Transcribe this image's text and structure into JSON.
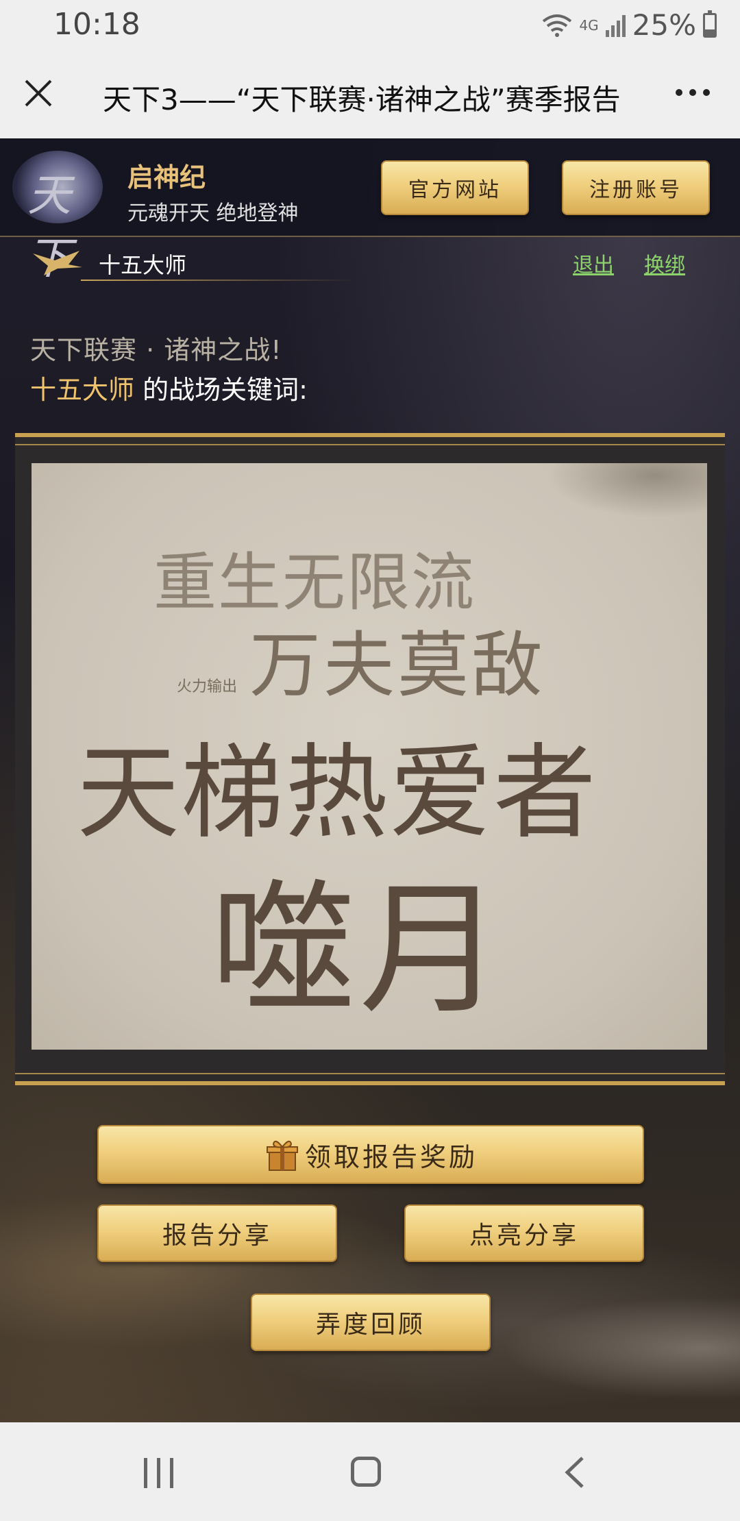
{
  "status_bar": {
    "time": "10:18",
    "network": "4G",
    "battery": "25%",
    "icons": [
      "wifi-icon",
      "cellular-signal-icon",
      "battery-icon"
    ]
  },
  "title_bar": {
    "title": "天下3——“天下联赛·诸神之战”赛季报告",
    "close_icon": "close-icon",
    "more_icon": "more-icon"
  },
  "game_header": {
    "logo_text": "天下",
    "game_name": "启神纪",
    "slogan": "元魂开天 绝地登神",
    "buttons": {
      "official_site": "官方网站",
      "register": "注册账号"
    }
  },
  "user_bar": {
    "username": "十五大师",
    "logout": "退出",
    "rebind": "换绑"
  },
  "intro": {
    "line1": "天下联赛 · 诸神之战!",
    "player": "十五大师",
    "line2_suffix": " 的战场关键词:"
  },
  "keywords": {
    "kw1": "重生无限流",
    "kw2": "万夫莫敌",
    "kw_small": "火力输出",
    "kw3": "天梯热爱者",
    "kw4": "噬月"
  },
  "actions": {
    "claim_reward": "领取报告奖励",
    "share_report": "报告分享",
    "light_share": "点亮分享",
    "annual_review": "弄度回顾"
  },
  "colors": {
    "accent_gold": "#f0c36c",
    "link_green": "#8bd36a",
    "button_gold": "#f0cf7e",
    "background_dark": "#1f1d2a"
  }
}
